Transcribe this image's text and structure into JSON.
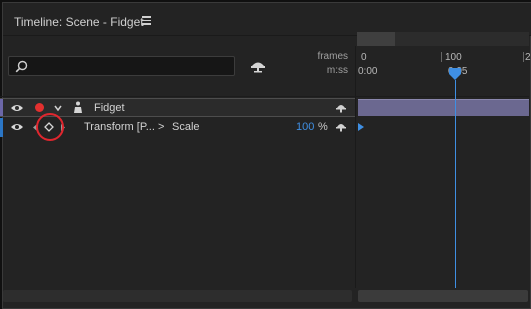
{
  "panel": {
    "title": "Timeline: Scene - Fidget",
    "menu_icon": "hamburger-menu-icon"
  },
  "search": {
    "value": "",
    "placeholder": "",
    "icon": "search-icon"
  },
  "ruler": {
    "frames_label": "frames",
    "time_label": "m:ss",
    "frame_ticks": [
      "0",
      "100",
      "2"
    ],
    "time_ticks": [
      "0:00",
      "0:05"
    ]
  },
  "layer": {
    "name": "Fidget",
    "label_color": "#6c67a8",
    "dot_color": "#e3302f",
    "icons": [
      "eye-icon",
      "red-dot-icon",
      "chevron-down-icon",
      "person-icon",
      "parent-icon"
    ]
  },
  "property": {
    "name": "Transform [P...",
    "separator": ">",
    "subname": "Scale",
    "value": "100",
    "unit": "%",
    "label_color": "#2b76c6",
    "icons": [
      "eye-icon",
      "keyframe-nav-left-icon",
      "keyframe-diamond-icon",
      "keyframe-nav-right-icon",
      "parent-icon"
    ]
  },
  "colors": {
    "accent": "#3f8fe3",
    "track_bar": "#6b6890",
    "highlight_circle": "#e0262e"
  }
}
